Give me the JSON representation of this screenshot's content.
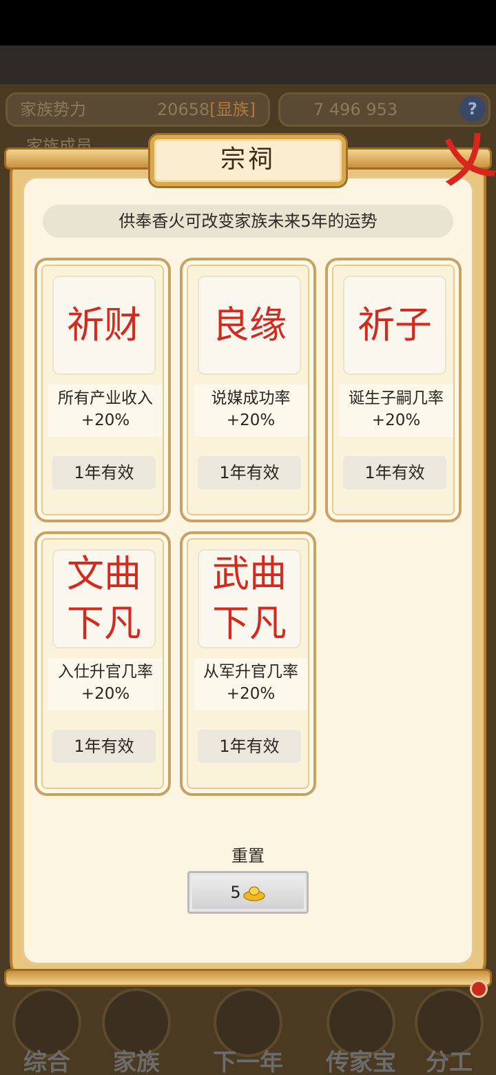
{
  "header": {
    "family_power_label": "家族势力",
    "family_power_value": "20658",
    "family_rank": "[显族]",
    "resources_text": "7 496 953",
    "help": "?",
    "second_row_text": "家族成员"
  },
  "dialog": {
    "title": "宗祠",
    "close_glyph": "乂",
    "subtitle": "供奉香火可改变家族未来5年的运势",
    "cards": [
      {
        "title": "祈财",
        "desc": "所有产业收入+20%",
        "duration": "1年有效"
      },
      {
        "title": "良缘",
        "desc": "说媒成功率+20%",
        "duration": "1年有效"
      },
      {
        "title": "祈子",
        "desc": "诞生子嗣几率+20%",
        "duration": "1年有效"
      },
      {
        "title": "文曲下凡",
        "desc": "入仕升官几率+20%",
        "duration": "1年有效"
      },
      {
        "title": "武曲下凡",
        "desc": "从军升官几率+20%",
        "duration": "1年有效"
      }
    ],
    "reset_label": "重置",
    "reset_cost": "5",
    "reset_cost_icon": "gold-ingot-icon"
  },
  "bottom_nav": [
    {
      "label": "综合"
    },
    {
      "label": "家族"
    },
    {
      "label": "下一年"
    },
    {
      "label": "传家宝"
    },
    {
      "label": "分工"
    }
  ],
  "colors": {
    "accent_red": "#d22a1f",
    "frame_gold": "#c9a262",
    "panel_cream": "#fbf5e2"
  }
}
